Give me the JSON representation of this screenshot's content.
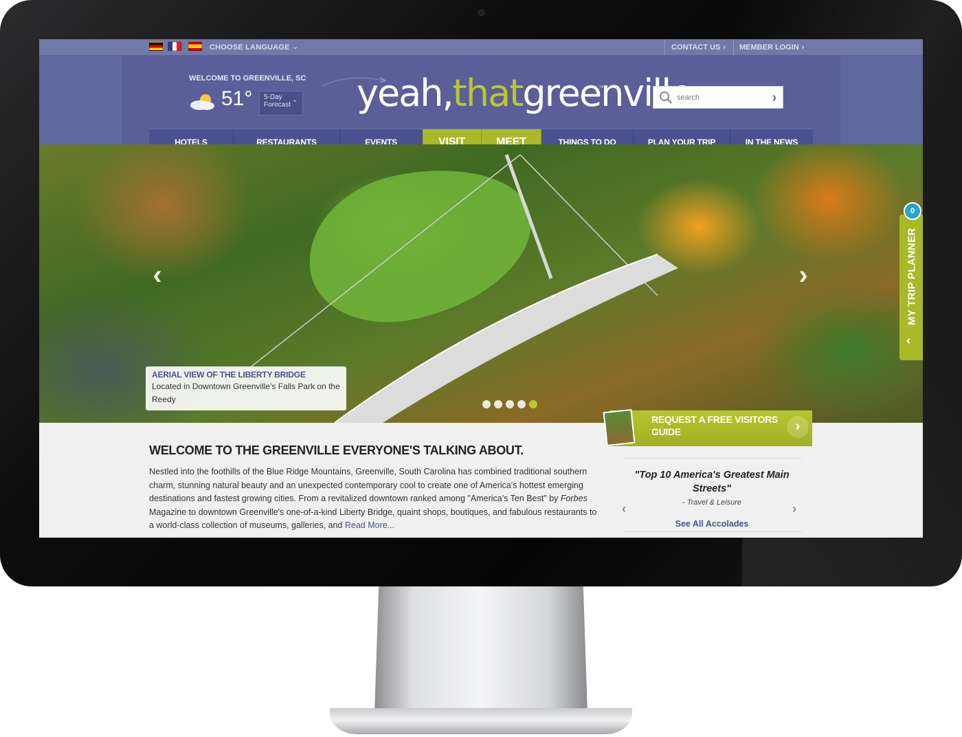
{
  "topbar": {
    "flags": [
      "de-flag-icon",
      "fr-flag-icon",
      "es-flag-icon"
    ],
    "language_label": "CHOOSE LANGUAGE",
    "contact_label": "CONTACT US",
    "login_label": "MEMBER LOGIN"
  },
  "header": {
    "welcome": "WELCOME TO GREENVILLE, SC",
    "temperature": "51°",
    "forecast_line1": "5-Day",
    "forecast_line2": "Forecast",
    "logo": {
      "part1": "yeah,",
      "part2": "that",
      "part3": "greenville",
      "tm": "™"
    },
    "search_placeholder": "search"
  },
  "nav": {
    "items": [
      {
        "label": "HOTELS"
      },
      {
        "label": "RESTAURANTS"
      },
      {
        "label": "EVENTS"
      },
      {
        "label": "VISIT"
      },
      {
        "label": "MEET"
      },
      {
        "label": "THINGS TO DO"
      },
      {
        "label": "PLAN YOUR TRIP"
      },
      {
        "label": "IN THE NEWS"
      }
    ]
  },
  "hero": {
    "caption_title": "AERIAL VIEW OF THE LIBERTY BRIDGE",
    "caption_text": "Located in Downtown Greenville's Falls Park on the Reedy",
    "slide_count": 5,
    "active_slide": 5
  },
  "planner": {
    "count": "0",
    "label": "MY TRIP PLANNER"
  },
  "cta": {
    "label": "REQUEST A FREE VISITORS GUIDE"
  },
  "content": {
    "headline": "WELCOME TO THE GREENVILLE EVERYONE'S TALKING ABOUT.",
    "body_before": "Nestled into the foothills of the Blue Ridge Mountains, Greenville, South Carolina has combined traditional southern charm, stunning natural beauty and an unexpected contemporary cool to create one of America's hottest emerging destinations and fastest growing cities. From a revitalized downtown ranked among \"America's Ten Best\" by ",
    "body_italic": "Forbes",
    "body_after": " Magazine to downtown Greenville's one-of-a-kind Liberty Bridge, quaint shops, boutiques, and fabulous restaurants to a world-class collection of museums, galleries, and ",
    "read_more": "Read More..."
  },
  "accolades": {
    "quote": "\"Top 10 America's Greatest Main Streets\"",
    "source": "- Travel & Leisure",
    "see_all": "See All Accolades"
  },
  "colors": {
    "header_blue": "#5a5f99",
    "nav_blue": "#4b5190",
    "accent_green": "#a9b92a",
    "planner_badge": "#2aa4c8"
  }
}
